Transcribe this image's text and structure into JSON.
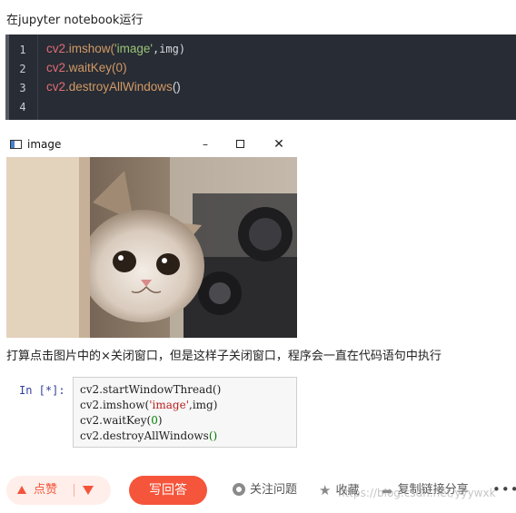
{
  "intro_text": "在jupyter notebook运行",
  "code_block": {
    "line_numbers": [
      "1",
      "2",
      "3",
      "4"
    ],
    "line1": {
      "obj": "cv2",
      "fn": ".imshow(",
      "str": "'image'",
      "arg": ",img)"
    },
    "line2": {
      "obj": "cv2",
      "fn": ".waitKey(",
      "num": "0",
      "close": ")"
    },
    "line3": {
      "obj": "cv2",
      "fn": ".destroyAllWindows",
      "close": "()"
    }
  },
  "image_window": {
    "title": "image",
    "minimize_glyph": "–",
    "close_glyph": "✕"
  },
  "description": "打算点击图片中的×关闭窗口，但是这样子关闭窗口，程序会一直在代码语句中执行",
  "jupyter_cell": {
    "prompt": "In  [*]:",
    "line1": "cv2.startWindowThread()",
    "line2_pre": "cv2.imshow(",
    "line2_str": "'image'",
    "line2_post": ",img)",
    "line3_pre": "cv2.waitKey(",
    "line3_num": "0",
    "line3_post": ")",
    "line4_pre": "cv2.destroyAllWindows",
    "line4_par": "()"
  },
  "toolbar": {
    "upvote_label": "点赞",
    "answer_label": "写回答",
    "follow_label": "关注问题",
    "favorite_label": "收藏",
    "share_label": "复制链接分享",
    "more_glyph": "•••"
  },
  "watermark": "https://blog.csdn.net/yyywxk",
  "colors": {
    "accent": "#f5553b",
    "code_bg": "#282c34"
  }
}
